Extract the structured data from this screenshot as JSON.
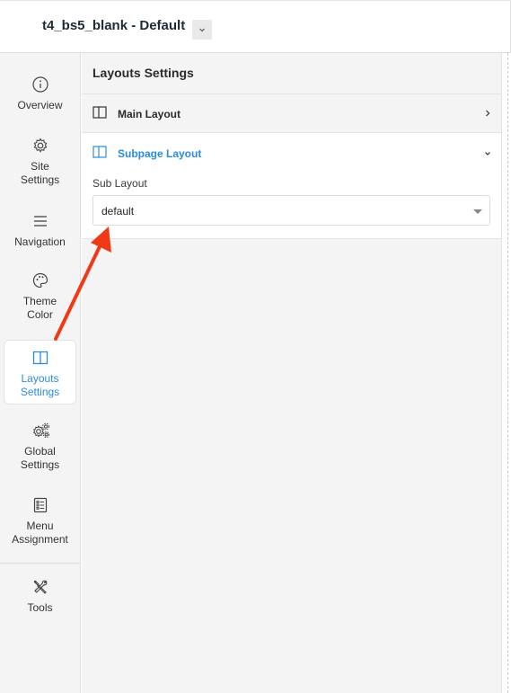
{
  "header": {
    "title": "t4_bs5_blank - Default"
  },
  "sidebar": {
    "items": [
      {
        "label": "Overview",
        "icon": "info-icon"
      },
      {
        "label": "Site Settings",
        "icon": "gear-icon"
      },
      {
        "label": "Navigation",
        "icon": "menu-icon"
      },
      {
        "label": "Theme Color",
        "icon": "palette-icon"
      },
      {
        "label": "Layouts Settings",
        "icon": "layout-icon"
      },
      {
        "label": "Global Settings",
        "icon": "gears-icon"
      },
      {
        "label": "Menu Assignment",
        "icon": "checklist-icon"
      },
      {
        "label": "Tools",
        "icon": "tools-icon"
      }
    ],
    "active": "Layouts Settings"
  },
  "panel": {
    "title": "Layouts Settings",
    "main_layout": {
      "label": "Main Layout"
    },
    "subpage_layout": {
      "label": "Subpage Layout",
      "field_label": "Sub Layout",
      "select_value": "default"
    }
  },
  "colors": {
    "accent": "#2a8ce0",
    "annotation_arrow": "#f03a17"
  }
}
